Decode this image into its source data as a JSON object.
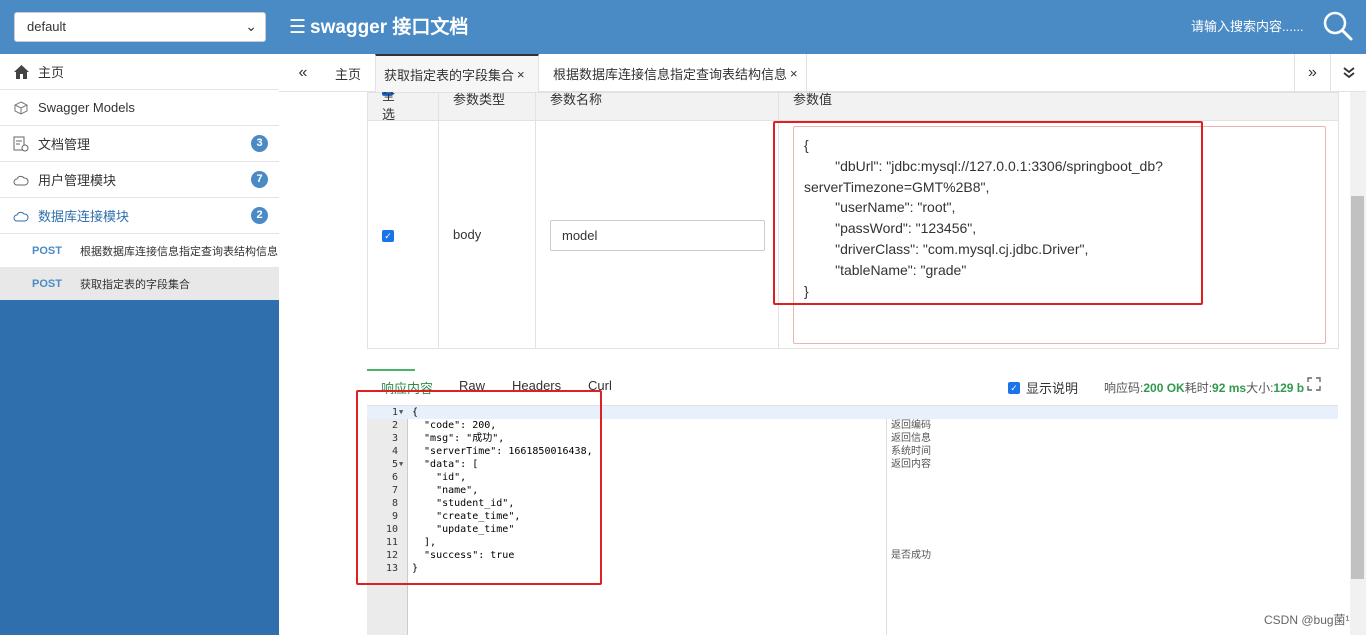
{
  "header": {
    "group_value": "default",
    "title": "swagger 接口文档",
    "menu_icon": "menu-icon",
    "search_placeholder": "请输入搜索内容......",
    "search_icon": "search-icon"
  },
  "sidebar": {
    "items": [
      {
        "label": "主页",
        "icon": "home-icon"
      },
      {
        "label": "Swagger Models",
        "icon": "cube-icon"
      },
      {
        "label": "文档管理",
        "icon": "doc-gear-icon",
        "badge": "3"
      },
      {
        "label": "用户管理模块",
        "icon": "cloud-icon",
        "badge": "7"
      },
      {
        "label": "数据库连接模块",
        "icon": "cloud-icon",
        "badge": "2"
      }
    ],
    "endpoints": [
      {
        "method": "POST",
        "label": "根据数据库连接信息指定查询表结构信息"
      },
      {
        "method": "POST",
        "label": "获取指定表的字段集合"
      }
    ]
  },
  "tabs": {
    "prev": "«",
    "next": "»",
    "more": "❯",
    "items": [
      {
        "label": "主页"
      },
      {
        "label": "获取指定表的字段集合",
        "close": "×"
      },
      {
        "label": "根据数据库连接信息指定查询表结构信息",
        "close": "×"
      }
    ]
  },
  "params": {
    "headers": [
      "全选",
      "参数类型",
      "参数名称",
      "参数值"
    ],
    "row": {
      "checked": "✓",
      "type": "body",
      "name": "model",
      "value_lines": [
        "{",
        "        \"dbUrl\": \"jdbc:mysql://127.0.0.1:3306/springboot_db?",
        "serverTimezone=GMT%2B8\",",
        "        \"userName\": \"root\",",
        "        \"passWord\": \"123456\",",
        "        \"driverClass\": \"com.mysql.cj.jdbc.Driver\",",
        "        \"tableName\": \"grade\"",
        "}"
      ]
    }
  },
  "response": {
    "tabs": [
      "响应内容",
      "Raw",
      "Headers",
      "Curl"
    ],
    "show_desc": "显示说明",
    "code_label": "响应码:",
    "code_value": "200 OK",
    "time_label": "耗时:",
    "time_value": "92 ms",
    "size_label": "大小:",
    "size_value": "129 b",
    "lines": [
      {
        "n": "1",
        "code": "{",
        "desc": "",
        "fold": true
      },
      {
        "n": "2",
        "code": "  \"code\": 200,",
        "desc": "返回编码"
      },
      {
        "n": "3",
        "code": "  \"msg\": \"成功\",",
        "desc": "返回信息"
      },
      {
        "n": "4",
        "code": "  \"serverTime\": 1661850016438,",
        "desc": "系统时间"
      },
      {
        "n": "5",
        "code": "  \"data\": [",
        "desc": "返回内容",
        "fold": true
      },
      {
        "n": "6",
        "code": "    \"id\",",
        "desc": ""
      },
      {
        "n": "7",
        "code": "    \"name\",",
        "desc": ""
      },
      {
        "n": "8",
        "code": "    \"student_id\",",
        "desc": ""
      },
      {
        "n": "9",
        "code": "    \"create_time\",",
        "desc": ""
      },
      {
        "n": "10",
        "code": "    \"update_time\"",
        "desc": ""
      },
      {
        "n": "11",
        "code": "  ],",
        "desc": ""
      },
      {
        "n": "12",
        "code": "  \"success\": true",
        "desc": "是否成功"
      },
      {
        "n": "13",
        "code": "}",
        "desc": ""
      }
    ]
  },
  "watermark": "CSDN @bug菌¹",
  "colors": {
    "header_bg": "#4a8bc6",
    "sidebar_bg": "#2f6fad",
    "highlight_box": "#e02020",
    "status_green": "#2e9a4b"
  }
}
